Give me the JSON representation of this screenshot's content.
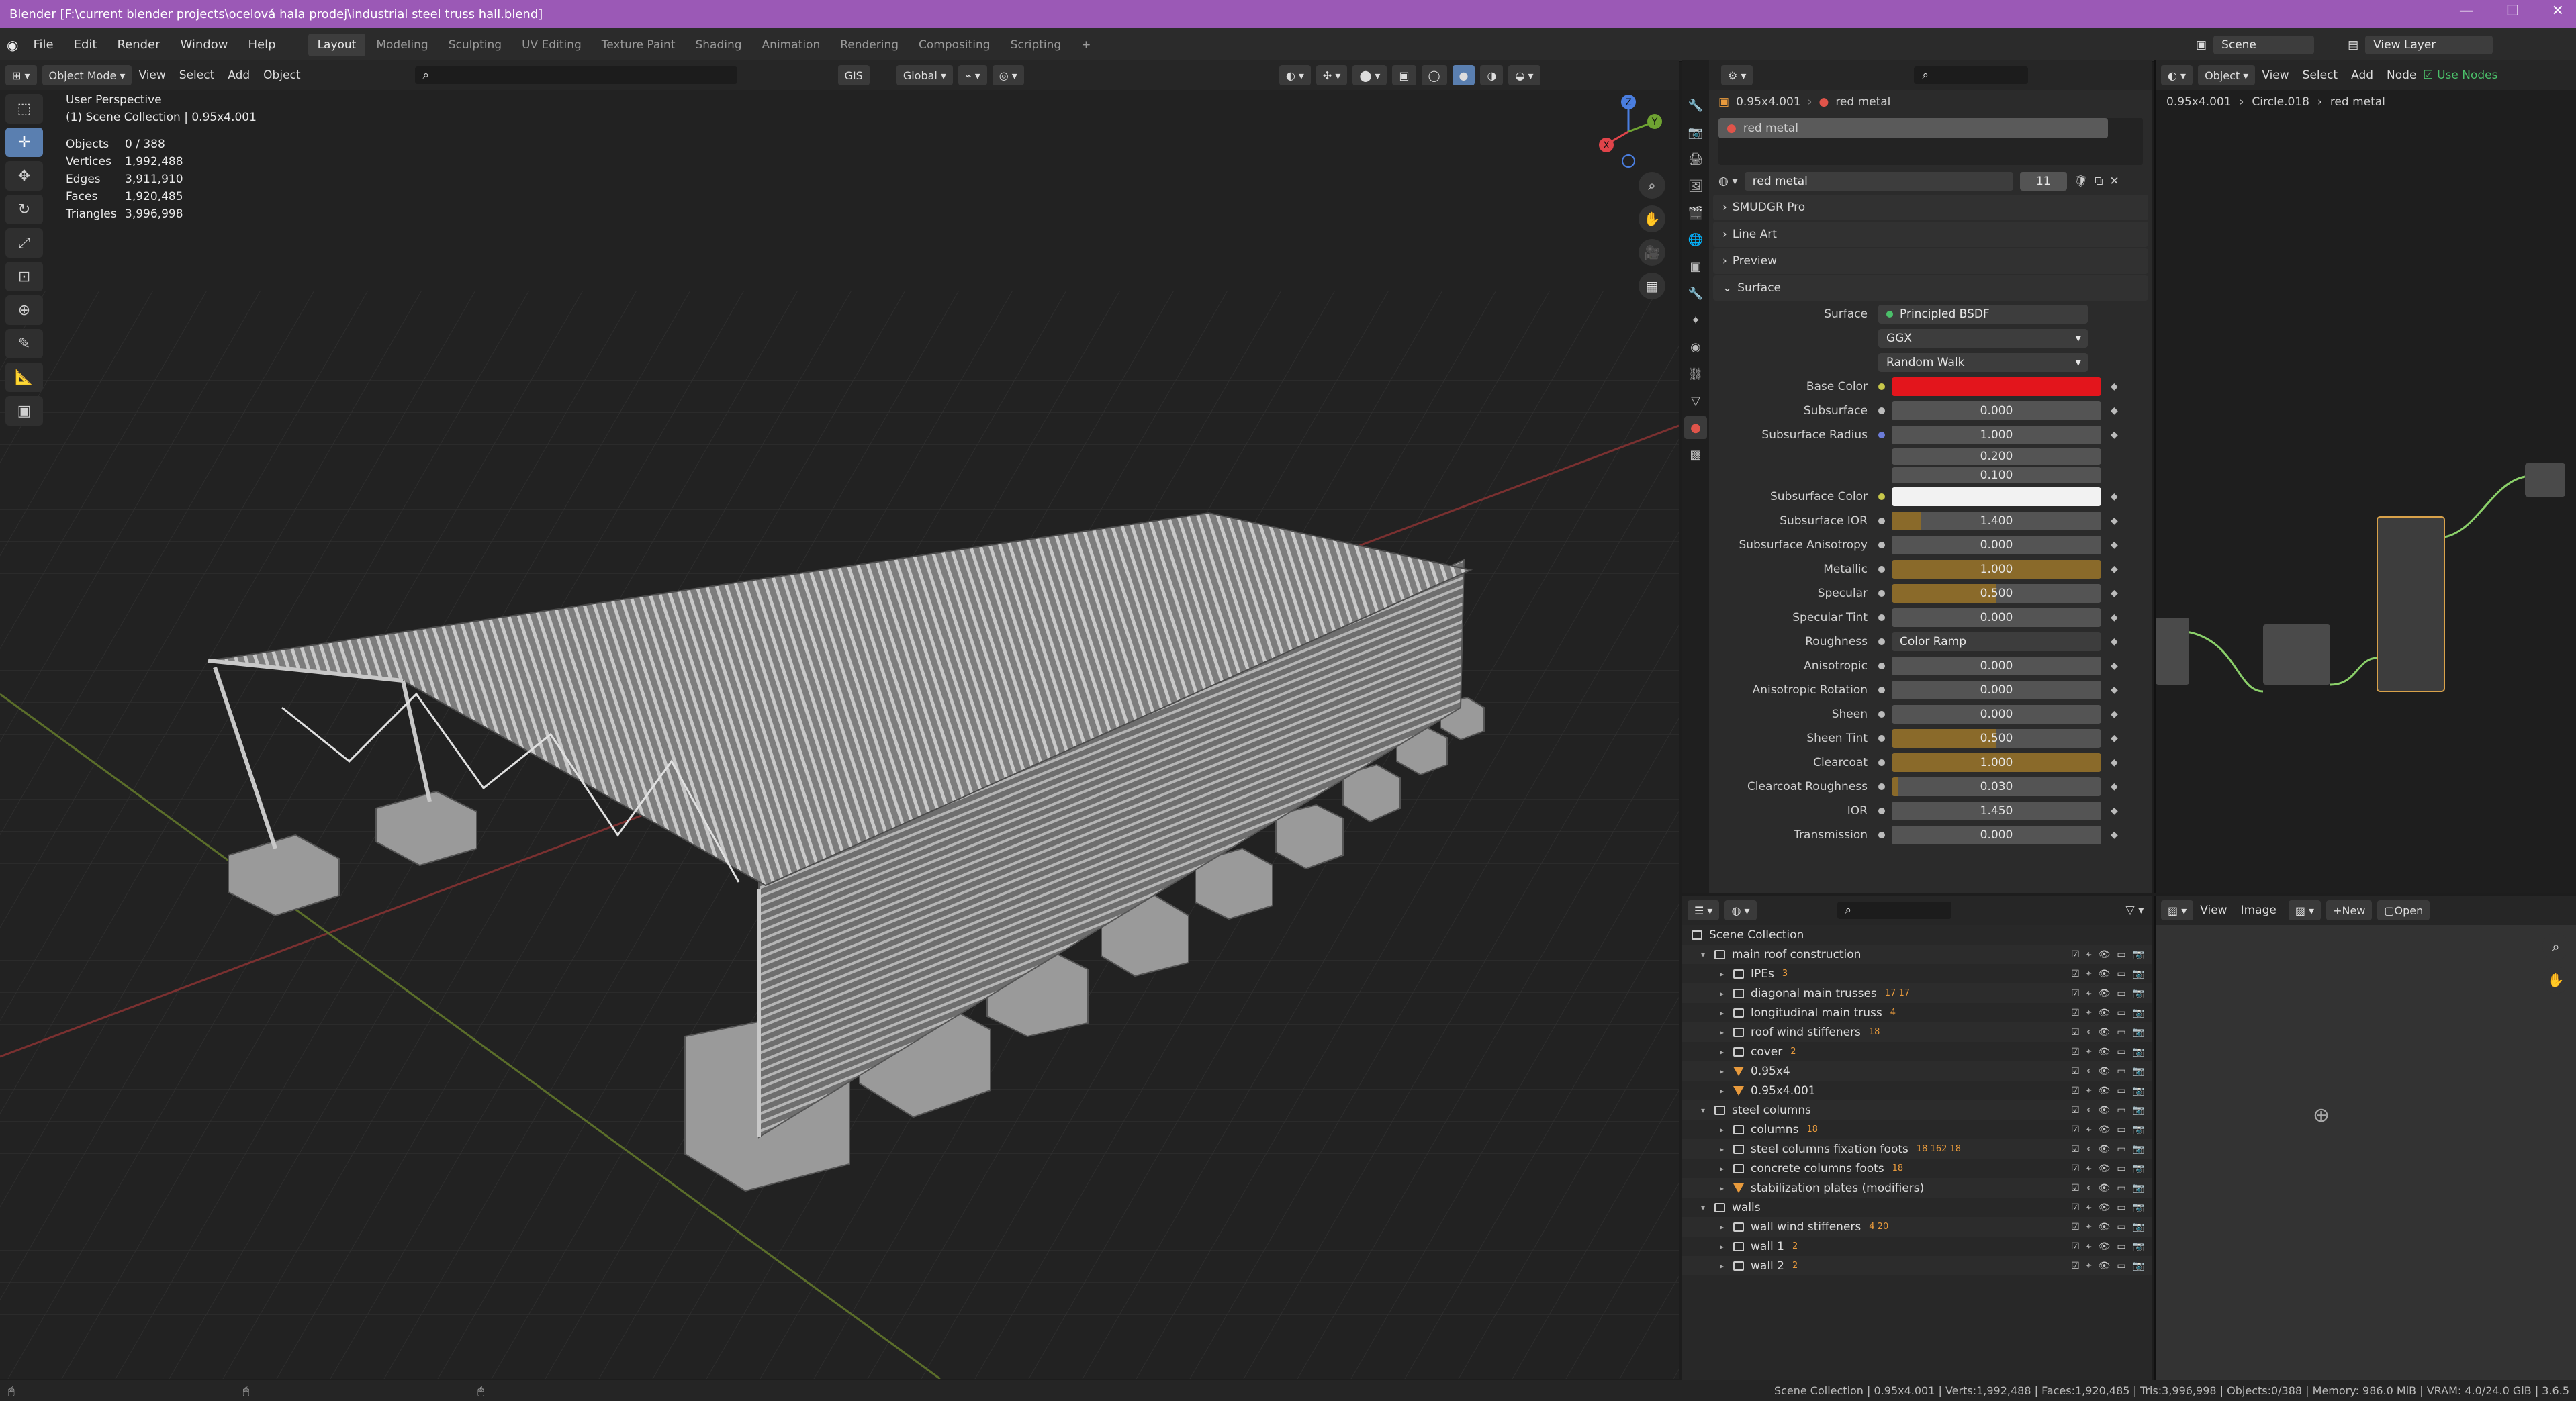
{
  "window": {
    "title": "Blender [F:\\current blender projects\\ocelová hala prodej\\industrial steel truss hall.blend]"
  },
  "menu": [
    "File",
    "Edit",
    "Render",
    "Window",
    "Help"
  ],
  "workspaces": [
    "Layout",
    "Modeling",
    "Sculpting",
    "UV Editing",
    "Texture Paint",
    "Shading",
    "Animation",
    "Rendering",
    "Compositing",
    "Scripting"
  ],
  "active_workspace": "Layout",
  "top_right": {
    "scene": "Scene",
    "view_layer": "View Layer"
  },
  "viewport_header": {
    "mode": "Object Mode",
    "menus": [
      "View",
      "Select",
      "Add",
      "Object"
    ],
    "gis": "GIS",
    "orientation": "Global"
  },
  "overlay_text": {
    "perspective": "User Perspective",
    "collection": "(1) Scene Collection | 0.95x4.001",
    "stats": [
      {
        "k": "Objects",
        "v": "0 / 388"
      },
      {
        "k": "Vertices",
        "v": "1,992,488"
      },
      {
        "k": "Edges",
        "v": "3,911,910"
      },
      {
        "k": "Faces",
        "v": "1,920,485"
      },
      {
        "k": "Triangles",
        "v": "3,996,998"
      }
    ]
  },
  "gizmo": {
    "x": "X",
    "y": "Y",
    "z": "Z"
  },
  "properties": {
    "breadcrumb_obj": "0.95x4.001",
    "breadcrumb_mat": "red metal",
    "slot_name": "red metal",
    "material_name": "red metal",
    "users": "11",
    "panels": [
      "SMUDGR Pro",
      "Line Art",
      "Preview",
      "Surface"
    ],
    "surface_label": "Surface",
    "surface_value": "Principled BSDF",
    "distribution": "GGX",
    "subsurface_method": "Random Walk",
    "rows": [
      {
        "label": "Base Color",
        "type": "color",
        "color": "#e3151c"
      },
      {
        "label": "Subsurface",
        "value": "0.000",
        "fill": 0
      },
      {
        "label": "Subsurface Radius",
        "value": "1.000",
        "fill": 0,
        "extra": [
          "0.200",
          "0.100"
        ]
      },
      {
        "label": "Subsurface Color",
        "type": "color",
        "color": "#f2f2f2"
      },
      {
        "label": "Subsurface IOR",
        "value": "1.400",
        "fill": 0.14
      },
      {
        "label": "Subsurface Anisotropy",
        "value": "0.000",
        "fill": 0
      },
      {
        "label": "Metallic",
        "value": "1.000",
        "fill": 1
      },
      {
        "label": "Specular",
        "value": "0.500",
        "fill": 0.5
      },
      {
        "label": "Specular Tint",
        "value": "0.000",
        "fill": 0
      },
      {
        "label": "Roughness",
        "type": "link",
        "value": "Color Ramp"
      },
      {
        "label": "Anisotropic",
        "value": "0.000",
        "fill": 0
      },
      {
        "label": "Anisotropic Rotation",
        "value": "0.000",
        "fill": 0
      },
      {
        "label": "Sheen",
        "value": "0.000",
        "fill": 0
      },
      {
        "label": "Sheen Tint",
        "value": "0.500",
        "fill": 0.5
      },
      {
        "label": "Clearcoat",
        "value": "1.000",
        "fill": 1
      },
      {
        "label": "Clearcoat Roughness",
        "value": "0.030",
        "fill": 0.03
      },
      {
        "label": "IOR",
        "value": "1.450",
        "fill": 0
      },
      {
        "label": "Transmission",
        "value": "0.000",
        "fill": 0
      }
    ]
  },
  "node_editor": {
    "object_mode": "Object",
    "menus": [
      "View",
      "Select",
      "Add",
      "Node"
    ],
    "use_nodes": "Use Nodes",
    "crumbs": [
      "0.95x4.001",
      "Circle.018",
      "red metal"
    ]
  },
  "outliner": {
    "root": "Scene Collection",
    "items": [
      {
        "name": "main roof construction",
        "depth": 0,
        "kind": "coll",
        "open": true
      },
      {
        "name": "IPEs",
        "depth": 1,
        "kind": "coll",
        "badge": "3"
      },
      {
        "name": "diagonal main trusses",
        "depth": 1,
        "kind": "coll",
        "badge": "17 17"
      },
      {
        "name": "longitudinal main truss",
        "depth": 1,
        "kind": "coll",
        "badge": "4"
      },
      {
        "name": "roof wind stiffeners",
        "depth": 1,
        "kind": "coll",
        "badge": "18"
      },
      {
        "name": "cover",
        "depth": 1,
        "kind": "coll",
        "badge": "2"
      },
      {
        "name": "0.95x4",
        "depth": 1,
        "kind": "mesh"
      },
      {
        "name": "0.95x4.001",
        "depth": 1,
        "kind": "mesh"
      },
      {
        "name": "steel columns",
        "depth": 0,
        "kind": "coll",
        "open": true
      },
      {
        "name": "columns",
        "depth": 1,
        "kind": "coll",
        "badge": "18"
      },
      {
        "name": "steel columns fixation foots",
        "depth": 1,
        "kind": "coll",
        "badge": "18 162 18"
      },
      {
        "name": "concrete columns foots",
        "depth": 1,
        "kind": "coll",
        "badge": "18"
      },
      {
        "name": "stabilization plates (modifiers)",
        "depth": 1,
        "kind": "mesh"
      },
      {
        "name": "walls",
        "depth": 0,
        "kind": "coll",
        "open": true
      },
      {
        "name": "wall wind stiffeners",
        "depth": 1,
        "kind": "coll",
        "badge": "4 20"
      },
      {
        "name": "wall 1",
        "depth": 1,
        "kind": "coll",
        "badge": "2"
      },
      {
        "name": "wall 2",
        "depth": 1,
        "kind": "coll",
        "badge": "2"
      }
    ]
  },
  "image_editor": {
    "menus": [
      "View",
      "Image"
    ],
    "new": "New",
    "open": "Open"
  },
  "status": "Scene Collection | 0.95x4.001 | Verts:1,992,488 | Faces:1,920,485 | Tris:3,996,998 | Objects:0/388 | Memory: 986.0 MiB | VRAM: 4.0/24.0 GiB | 3.6.5"
}
